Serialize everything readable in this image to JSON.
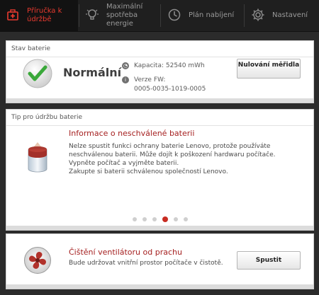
{
  "tabs": [
    {
      "label": "Příručka k údržbě",
      "icon": "first-aid-icon",
      "active": true
    },
    {
      "label": "Maximální spotřeba energie",
      "icon": "lightbulb-icon",
      "active": false
    },
    {
      "label": "Plán nabíjení",
      "icon": "clock-icon",
      "active": false
    },
    {
      "label": "Nastavení",
      "icon": "gear-icon",
      "active": false
    }
  ],
  "battery_status": {
    "section_title": "Stav baterie",
    "status": "Normální",
    "capacity": "Kapacita: 52540 mWh",
    "fw_label": "Verze FW:",
    "fw_value": "0005-0035-1019-0005",
    "reset_button": "Nulování měřidla"
  },
  "tip": {
    "section_title": "Tip pro údržbu baterie",
    "title": "Informace o neschválené baterii",
    "lines": [
      "Nelze spustit funkci ochrany baterie Lenovo, protože používáte",
      "neschválenou baterii. Může dojít k poškození hardwaru počítače.",
      "Vypněte počítač a vyjměte baterii.",
      "Zakupte si baterii schválenou společností Lenovo."
    ],
    "pager_count": 6,
    "pager_active": 4
  },
  "fan": {
    "title": "Čištění ventilátoru od prachu",
    "description": "Bude udržovat vnitřní prostor počítače v čistotě.",
    "button": "Spustit"
  },
  "colors": {
    "accent": "#e83a2f",
    "heading_red": "#a52020",
    "check_green": "#3aa83a"
  }
}
